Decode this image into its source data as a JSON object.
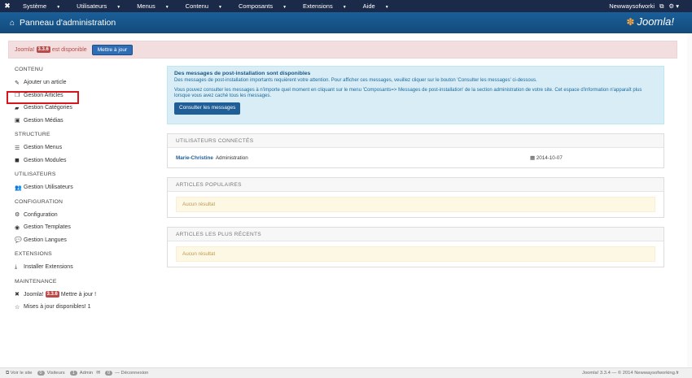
{
  "topbar": {
    "menu": [
      "Système",
      "Utilisateurs",
      "Menus",
      "Contenu",
      "Composants",
      "Extensions",
      "Aide"
    ],
    "site_name": "Newwaysofworki",
    "ext_icon": "external-link-icon",
    "gear_icon": "gear-icon"
  },
  "header": {
    "title": "Panneau d'administration",
    "logo": "Joomla!"
  },
  "alert": {
    "text_before": "Joomla!",
    "version": "3.3.6",
    "text_after": "est disponible",
    "button": "Mettre à jour"
  },
  "sidebar": {
    "sections": [
      {
        "title": "CONTENU",
        "items": [
          {
            "icon": "pencil-icon",
            "label": "Ajouter un article"
          },
          {
            "icon": "stack-icon",
            "label": "Gestion Articles"
          },
          {
            "icon": "folder-icon",
            "label": "Gestion Catégories"
          },
          {
            "icon": "image-icon",
            "label": "Gestion Médias"
          }
        ]
      },
      {
        "title": "STRUCTURE",
        "items": [
          {
            "icon": "list-icon",
            "label": "Gestion Menus"
          },
          {
            "icon": "cube-icon",
            "label": "Gestion Modules"
          }
        ]
      },
      {
        "title": "UTILISATEURS",
        "items": [
          {
            "icon": "users-icon",
            "label": "Gestion Utilisateurs"
          }
        ]
      },
      {
        "title": "CONFIGURATION",
        "items": [
          {
            "icon": "cog-icon",
            "label": "Configuration"
          },
          {
            "icon": "eye-icon",
            "label": "Gestion Templates"
          },
          {
            "icon": "comments-icon",
            "label": "Gestion Langues"
          }
        ]
      },
      {
        "title": "EXTENSIONS",
        "items": [
          {
            "icon": "download-icon",
            "label": "Installer Extensions"
          }
        ]
      },
      {
        "title": "MAINTENANCE",
        "items": [
          {
            "icon": "joomla-icon",
            "label": "Joomla!",
            "badge": "3.3.6",
            "label2": "Mettre à jour !"
          },
          {
            "icon": "star-icon",
            "label": "Mises à jour disponibles! 1"
          }
        ]
      }
    ]
  },
  "postinstall": {
    "title": "Des messages de post-installation sont disponibles",
    "line1": "Des messages de post-installation importants requièrent votre attention. Pour afficher ces messages, veuillez cliquer sur le bouton 'Consulter les messages' ci-dessous.",
    "line2": "Vous pouvez consulter les messages à n'importe quel moment en cliquant sur le menu 'Composants=> Messages de post-installation' de la section administration de votre site. Cet espace d'information n'apparaît plus lorsque vous avez caché tous les messages.",
    "button": "Consulter les messages"
  },
  "panels": {
    "users_title": "UTILISATEURS CONNECTÉS",
    "user_name": "Marie-Christine",
    "user_role": "Administration",
    "user_date": "2014-10-07",
    "popular_title": "ARTICLES POPULAIRES",
    "popular_empty": "Aucun résultat",
    "recent_title": "ARTICLES LES PLUS RÉCENTS",
    "recent_empty": "Aucun résultat"
  },
  "footer": {
    "view_site": "Voir le site",
    "visitors_count": "0",
    "visitors": "Visiteurs",
    "admin_count": "1",
    "admin": "Admin",
    "msg_count": "0",
    "logout": "Déconnexion",
    "copyright": "Joomla! 3.3.4 — © 2014 Newwaysofworking.fr"
  }
}
